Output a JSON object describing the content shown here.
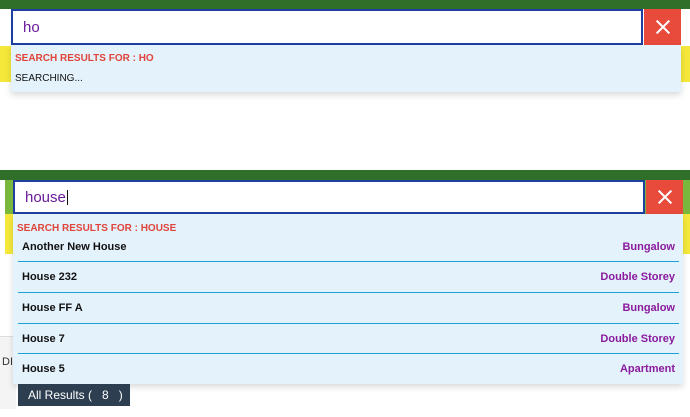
{
  "panel_top": {
    "search_value": "ho",
    "results_heading": "SEARCH RESULTS FOR : HO",
    "status": "SEARCHING..."
  },
  "panel_bottom": {
    "search_value": "house",
    "results_heading": "SEARCH RESULTS FOR : HOUSE",
    "results": [
      {
        "name": "Another New House",
        "type": "Bungalow"
      },
      {
        "name": "House 232",
        "type": "Double Storey"
      },
      {
        "name": "House FF A",
        "type": "Bungalow"
      },
      {
        "name": "House 7",
        "type": "Double Storey"
      },
      {
        "name": "House 5",
        "type": "Apartment"
      }
    ],
    "all_results_label": "All Results (",
    "all_results_count": "8",
    "all_results_close": ")",
    "side_fragment": "DI"
  },
  "colors": {
    "header_green": "#2f6f2a",
    "accent_yellow": "#f5e83a",
    "close_red": "#e84a3c",
    "heading_red": "#e0443a",
    "type_purple": "#8b1a9e",
    "row_divider": "#1ea0d6"
  },
  "icons": {
    "close": "close-icon"
  }
}
